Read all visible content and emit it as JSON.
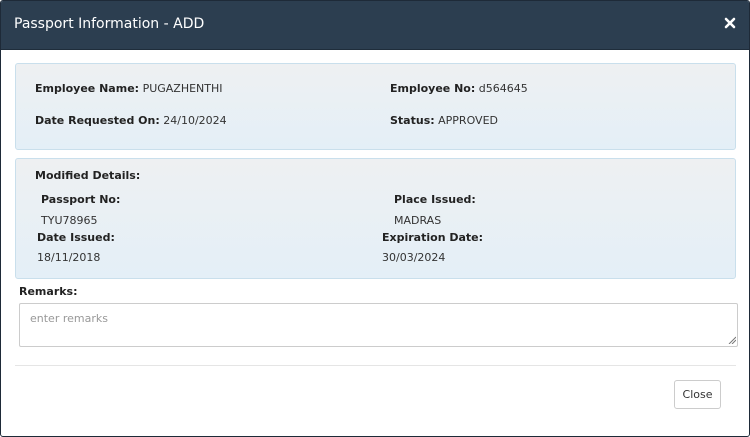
{
  "header": {
    "title": "Passport Information - ADD",
    "close_icon": "close-icon"
  },
  "summary": {
    "employee_name_label": "Employee Name:",
    "employee_name_value": "PUGAZHENTHI",
    "employee_no_label": "Employee No:",
    "employee_no_value": "d564645",
    "date_requested_label": "Date Requested On:",
    "date_requested_value": "24/10/2024",
    "status_label": "Status:",
    "status_value": "APPROVED"
  },
  "modified": {
    "heading": "Modified Details:",
    "passport_no_label": "Passport No:",
    "passport_no_value": "TYU78965",
    "place_issued_label": "Place Issued:",
    "place_issued_value": "MADRAS",
    "date_issued_label": "Date Issued:",
    "date_issued_value": "18/11/2018",
    "expiration_label": "Expiration Date:",
    "expiration_value": "30/03/2024"
  },
  "remarks": {
    "label": "Remarks:",
    "placeholder": "enter remarks",
    "value": ""
  },
  "footer": {
    "close_label": "Close"
  },
  "colors": {
    "header_bg": "#2c3e50",
    "header_text": "#ffffff",
    "panel_bg": "#e4eff7",
    "panel_border": "#c9dfec"
  }
}
